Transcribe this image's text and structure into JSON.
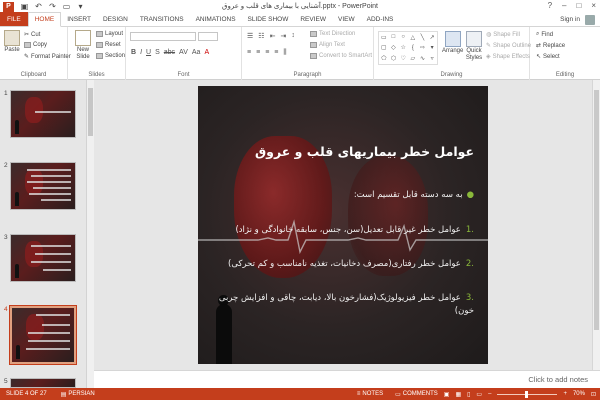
{
  "titlebar": {
    "app_icon": "P",
    "doc_title": "آشنایی با بیماری های قلب و عروق.pptx - PowerPoint",
    "window_controls": [
      "?",
      "–",
      "□",
      "×"
    ]
  },
  "tabs": {
    "file": "FILE",
    "items": [
      "HOME",
      "INSERT",
      "DESIGN",
      "TRANSITIONS",
      "ANIMATIONS",
      "SLIDE SHOW",
      "REVIEW",
      "VIEW",
      "ADD-INS"
    ],
    "active": "HOME",
    "signin": "Sign in"
  },
  "ribbon": {
    "clipboard": {
      "paste": "Paste",
      "cut": "Cut",
      "copy": "Copy",
      "format_painter": "Format Painter",
      "label": "Clipboard"
    },
    "slides": {
      "new_slide": "New Slide",
      "layout": "Layout",
      "reset": "Reset",
      "section": "Section",
      "label": "Slides"
    },
    "font": {
      "label": "Font",
      "format_buttons": [
        "B",
        "I",
        "U",
        "S",
        "abc",
        "AV",
        "Aa",
        "A"
      ]
    },
    "paragraph": {
      "text_direction": "Text Direction",
      "align_text": "Align Text",
      "convert_smartart": "Convert to SmartArt",
      "label": "Paragraph"
    },
    "drawing": {
      "arrange": "Arrange",
      "quick_styles": "Quick Styles",
      "shape_fill": "Shape Fill",
      "shape_outline": "Shape Outline",
      "shape_effects": "Shape Effects",
      "label": "Drawing"
    },
    "editing": {
      "find": "Find",
      "replace": "Replace",
      "select": "Select",
      "label": "Editing"
    }
  },
  "thumbnails": {
    "numbers": [
      "1",
      "2",
      "3",
      "4",
      "5"
    ],
    "selected": "4"
  },
  "slide": {
    "title": "عوامل خطر بیماریهای قلب و عروق",
    "intro": "به سه دسته قابل تقسیم است:",
    "items": [
      {
        "num": ".1",
        "text": "عوامل خطر غیر قابل تعدیل(سن، جنس، سابقه خانوادگی و نژاد)"
      },
      {
        "num": ".2",
        "text": "عوامل خطر رفتاری(مصرف دخانیات، تغذیه نامناسب و کم تحرکی)"
      },
      {
        "num": ".3",
        "text": "عوامل خطر فیزیولوژیک(فشارخون بالا، دیابت، چاقی و افزایش چربی خون)"
      }
    ],
    "bullet_color": "#8ab83a"
  },
  "notes": {
    "placeholder": "Click to add notes"
  },
  "statusbar": {
    "slide_info": "SLIDE 4 OF 27",
    "language": "PERSIAN",
    "notes": "NOTES",
    "comments": "COMMENTS",
    "zoom": "70%"
  },
  "colors": {
    "accent": "#c43e1c"
  }
}
